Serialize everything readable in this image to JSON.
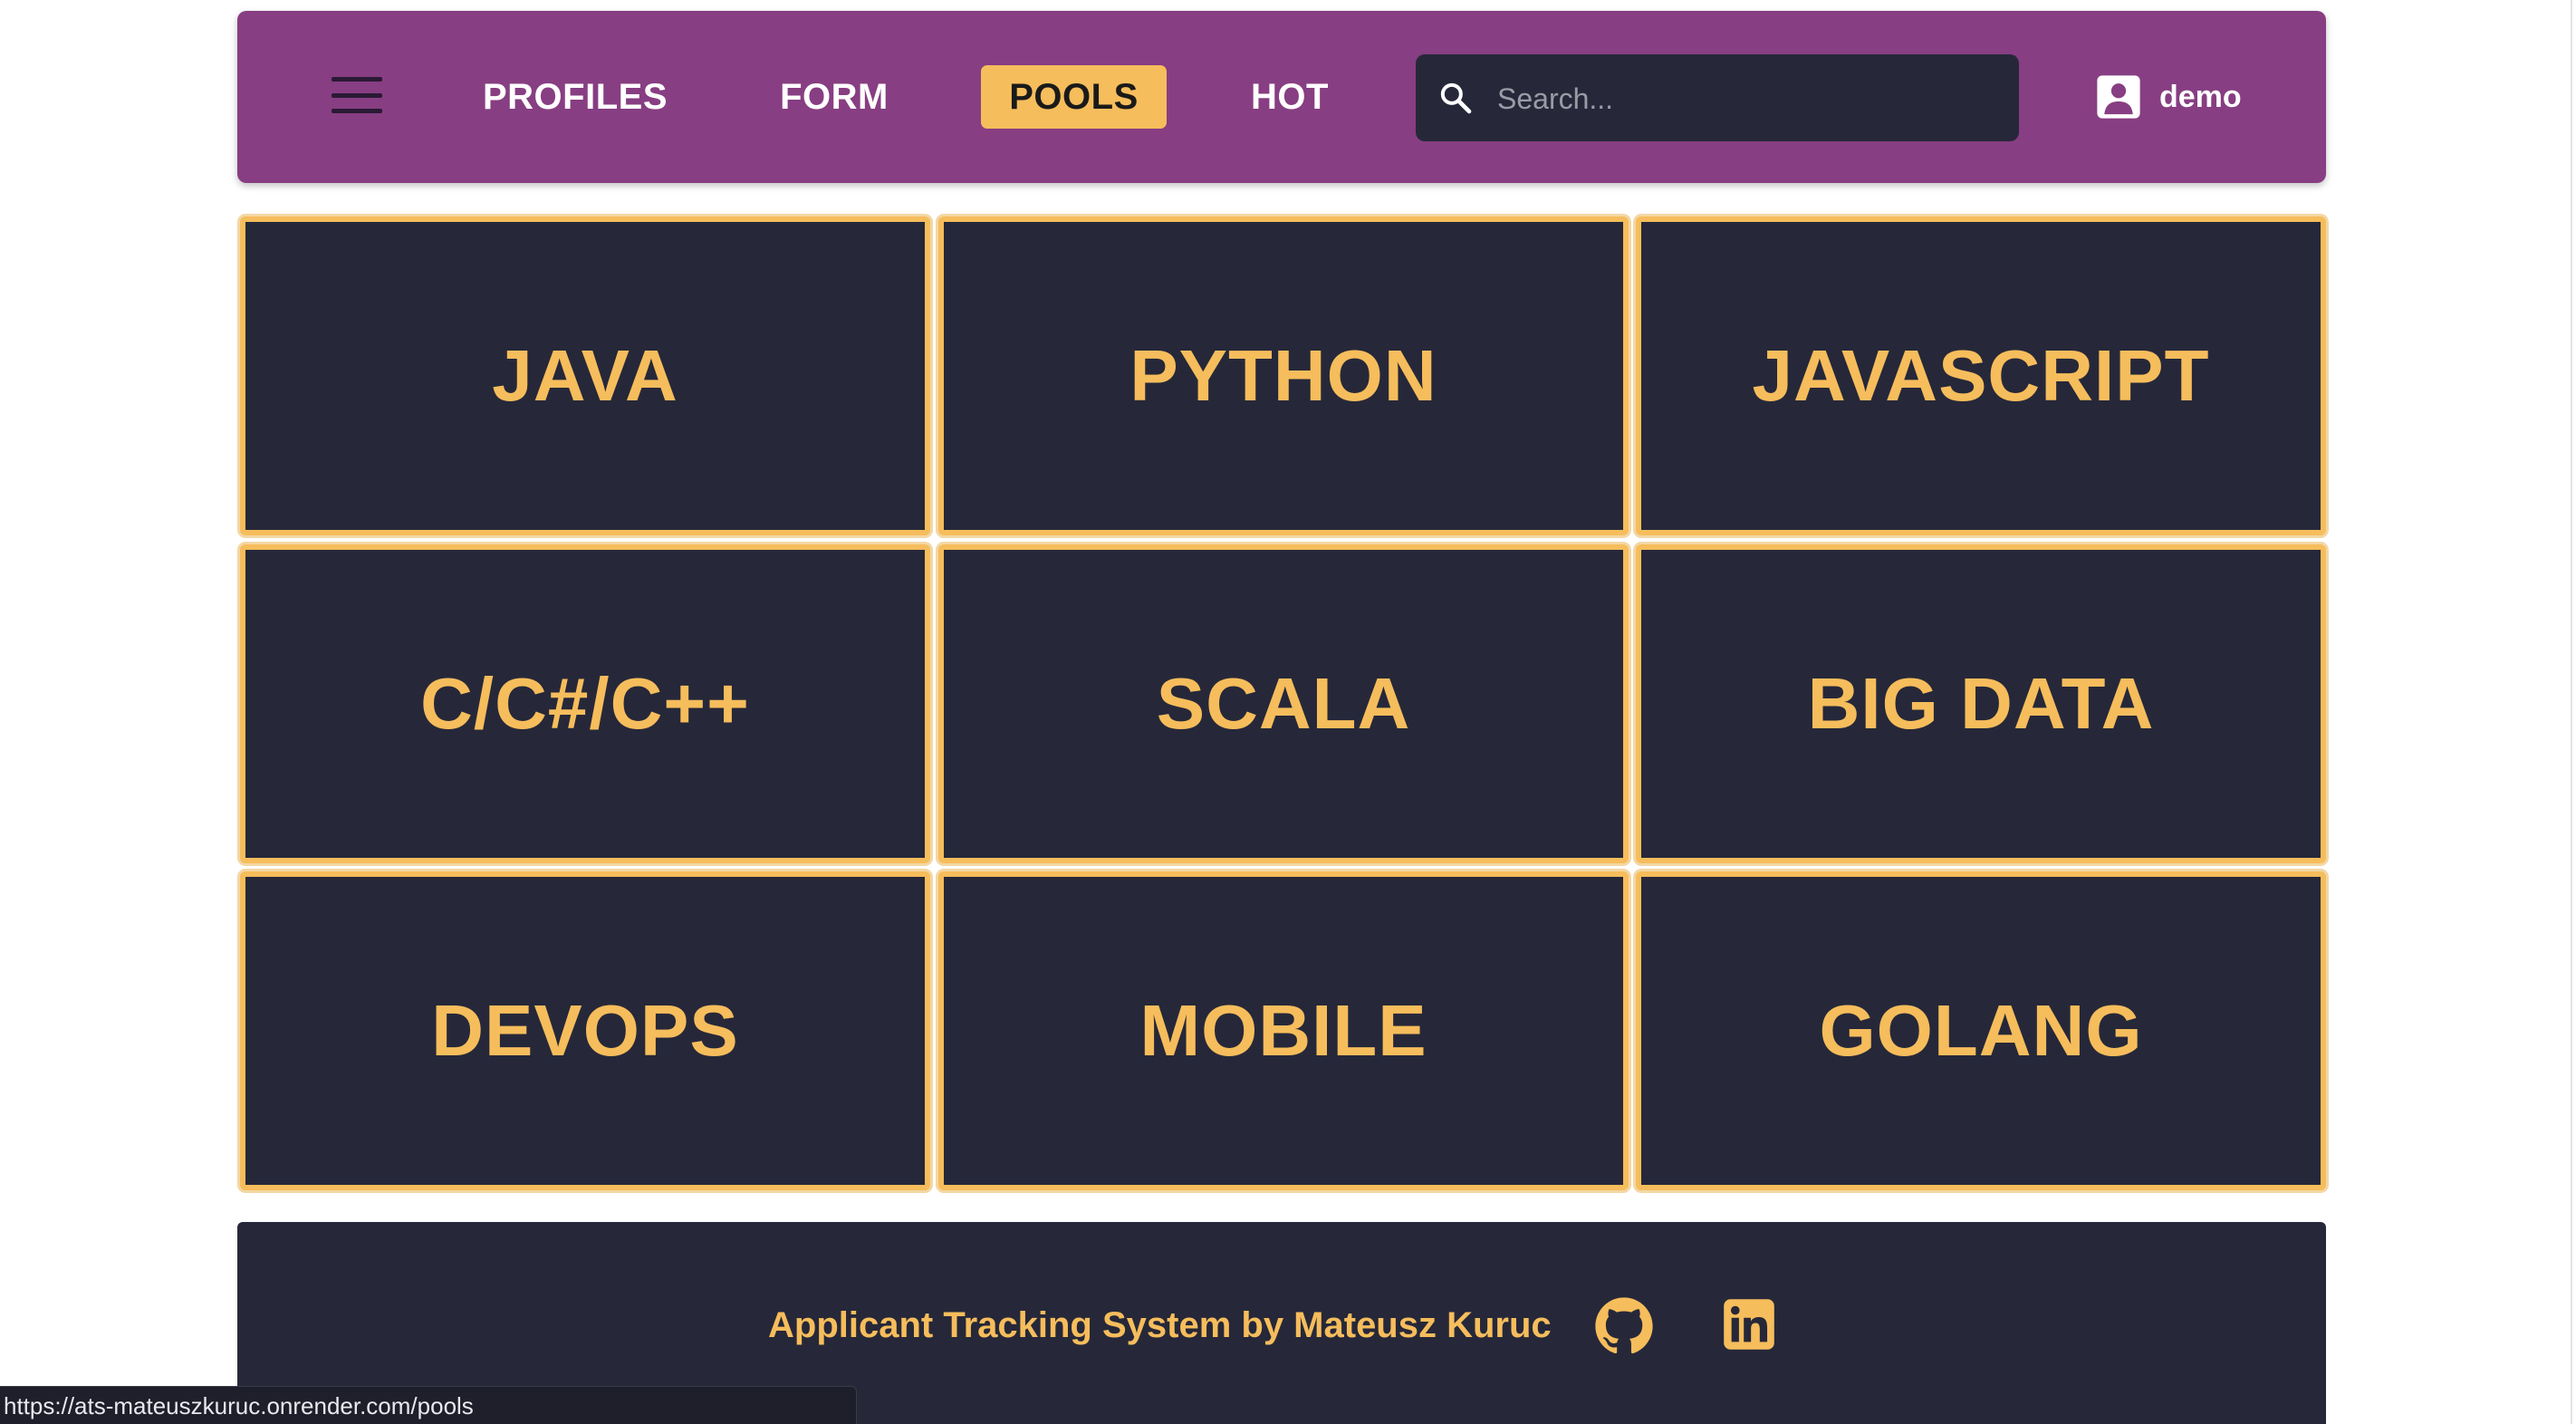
{
  "navbar": {
    "menu_icon": "hamburger-menu-icon",
    "items": [
      {
        "label": "PROFILES",
        "active": false
      },
      {
        "label": "FORM",
        "active": false
      },
      {
        "label": "POOLS",
        "active": true
      },
      {
        "label": "HOT",
        "active": false
      }
    ],
    "search": {
      "placeholder": "Search...",
      "value": "",
      "icon": "search-icon"
    },
    "user": {
      "name": "demo",
      "icon": "account-box-icon"
    }
  },
  "pools": [
    {
      "label": "JAVA"
    },
    {
      "label": "PYTHON"
    },
    {
      "label": "JAVASCRIPT"
    },
    {
      "label": "C/C#/C++"
    },
    {
      "label": "SCALA"
    },
    {
      "label": "BIG DATA"
    },
    {
      "label": "DEVOPS"
    },
    {
      "label": "MOBILE"
    },
    {
      "label": "GOLANG"
    }
  ],
  "footer": {
    "text": "Applicant Tracking System by Mateusz Kuruc",
    "github_icon": "github-icon",
    "linkedin_icon": "linkedin-icon"
  },
  "status_bar": {
    "url": "https://ats-mateuszkuruc.onrender.com/pools"
  },
  "colors": {
    "navbar_bg": "#873e82",
    "accent": "#f6bd5c",
    "dark_bg": "#262839",
    "text_light": "#ffffff"
  }
}
